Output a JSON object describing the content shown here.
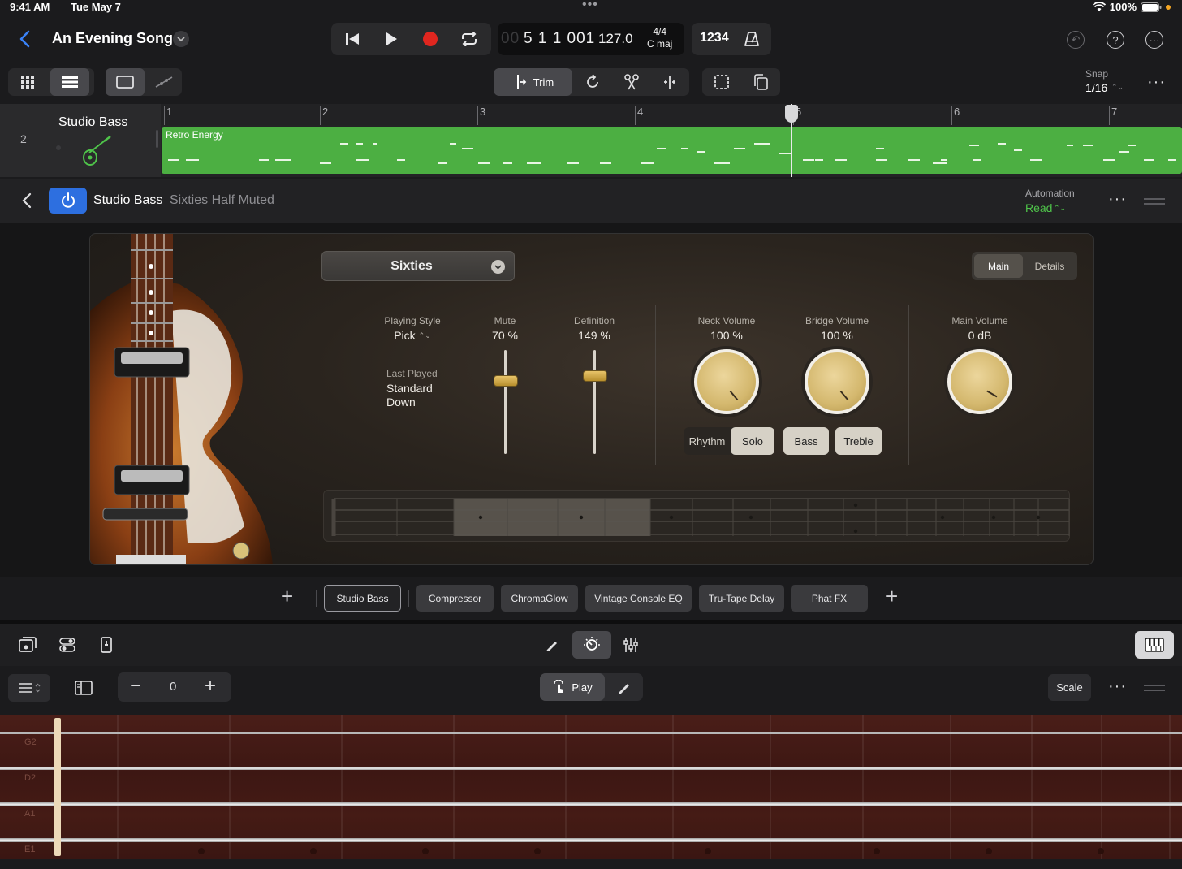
{
  "status": {
    "time": "9:41 AM",
    "date": "Tue May 7",
    "battery": "100%"
  },
  "header": {
    "song_title": "An Evening Song",
    "position": "5 1 1 001",
    "position_prefix": "00",
    "tempo": "127.0",
    "time_signature": "4/4",
    "key": "C maj",
    "count_in": "1234"
  },
  "tools": {
    "trim_label": "Trim",
    "snap_label": "Snap",
    "snap_value": "1/16"
  },
  "track": {
    "number": "2",
    "name": "Studio Bass",
    "region_label": "Retro Energy",
    "ruler": [
      "1",
      "2",
      "3",
      "4",
      "5",
      "6",
      "7"
    ]
  },
  "plugin": {
    "name": "Studio Bass",
    "preset": "Sixties Half Muted",
    "automation_label": "Automation",
    "automation_value": "Read"
  },
  "instrument": {
    "preset_dropdown": "Sixties",
    "tabs": [
      "Main",
      "Details"
    ],
    "active_tab": "Main",
    "playing_style": {
      "label": "Playing Style",
      "value": "Pick"
    },
    "last_played": {
      "label": "Last Played",
      "line1": "Standard",
      "line2": "Down"
    },
    "mute": {
      "label": "Mute",
      "value": "70 %",
      "level": 0.7
    },
    "definition": {
      "label": "Definition",
      "value": "149 %",
      "level": 0.75
    },
    "neck_volume": {
      "label": "Neck Volume",
      "value": "100 %"
    },
    "bridge_volume": {
      "label": "Bridge Volume",
      "value": "100 %"
    },
    "main_volume": {
      "label": "Main Volume",
      "value": "0 dB"
    },
    "tone_buttons": [
      "Rhythm",
      "Solo",
      "Bass",
      "Treble"
    ]
  },
  "plugin_strip": {
    "slots": [
      "Studio Bass",
      "Compressor",
      "ChromaGlow",
      "Vintage Console EQ",
      "Tru-Tape Delay",
      "Phat FX"
    ],
    "selected": "Studio Bass"
  },
  "bottom": {
    "octave_value": "0",
    "play_label": "Play",
    "scale_label": "Scale"
  },
  "neck": {
    "strings": [
      "G2",
      "D2",
      "A1",
      "E1"
    ]
  },
  "colors": {
    "accent_blue": "#2d6fe0",
    "region_green": "#4caf42",
    "automation_green": "#4fc44a",
    "knob_gold": "#d4b86e"
  }
}
